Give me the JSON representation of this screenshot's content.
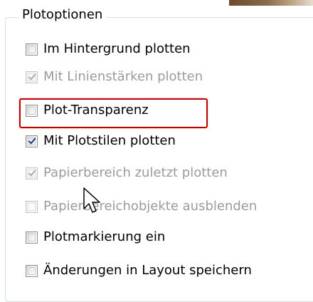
{
  "group": {
    "title": "Plotoptionen"
  },
  "options": [
    {
      "label": "Im Hintergrund plotten",
      "checked": false,
      "enabled": true
    },
    {
      "label": "Mit Linienstärken plotten",
      "checked": true,
      "enabled": false
    },
    {
      "label": "Plot-Transparenz",
      "checked": false,
      "enabled": true
    },
    {
      "label": "Mit Plotstilen plotten",
      "checked": true,
      "enabled": true
    },
    {
      "label": "Papierbereich zuletzt plotten",
      "checked": true,
      "enabled": false
    },
    {
      "label": "Papierbereichobjekte ausblenden",
      "checked": false,
      "enabled": false
    },
    {
      "label": "Plotmarkierung ein",
      "checked": false,
      "enabled": true
    },
    {
      "label": "Änderungen in Layout speichern",
      "checked": false,
      "enabled": true
    }
  ],
  "colors": {
    "highlight_border": "#c00000",
    "check_enabled": "#1e3f7d",
    "check_disabled": "#a8a8a8",
    "text_disabled": "#9b9b9b"
  }
}
